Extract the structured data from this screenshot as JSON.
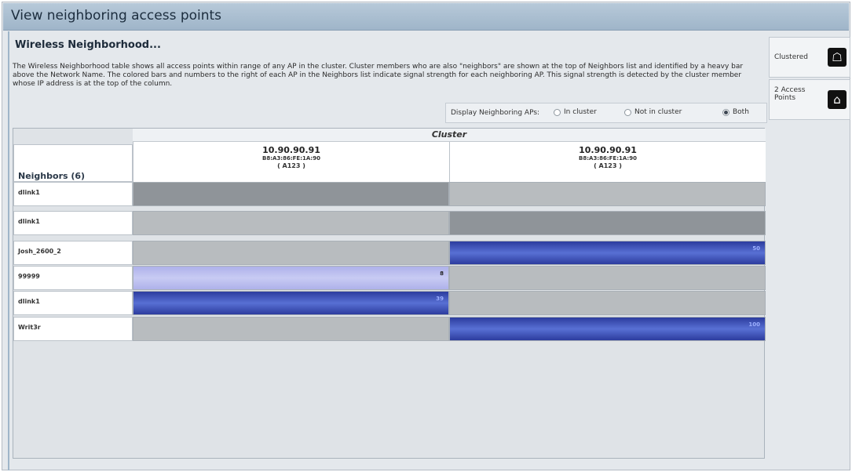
{
  "page_title": "View neighboring access points",
  "section_heading": "Wireless Neighborhood...",
  "description": "The Wireless Neighborhood table shows all access points within range of any AP in the cluster. Cluster members who are also \"neighbors\" are shown at the top of Neighbors list and identified by a heavy bar above the Network Name. The colored bars and numbers to the right of each AP in the Neighbors list indicate signal strength for each neighboring AP. This signal strength is detected by the cluster member whose IP address is at the top of the column.",
  "display_filter": {
    "label": "Display Neighboring APs:",
    "options": [
      {
        "label": "In cluster",
        "selected": false
      },
      {
        "label": "Not in cluster",
        "selected": false
      },
      {
        "label": "Both",
        "selected": true
      }
    ]
  },
  "grid": {
    "cluster_label": "Cluster",
    "neighbors_header": "Neighbors (6)",
    "access_points": [
      {
        "ip": "10.90.90.91",
        "mac": "B8:A3:86:FE:1A:90",
        "name": "( A123 )"
      },
      {
        "ip": "10.90.90.91",
        "mac": "B8:A3:86:FE:1A:90",
        "name": "( A123 )"
      }
    ],
    "rows": [
      {
        "name": "dlink1",
        "signals": [
          {
            "kind": "self",
            "value": ""
          },
          {
            "kind": "empty",
            "value": ""
          }
        ]
      },
      {
        "name": "dlink1",
        "signals": [
          {
            "kind": "empty",
            "value": ""
          },
          {
            "kind": "self",
            "value": ""
          }
        ]
      },
      {
        "name": "Josh_2600_2",
        "signals": [
          {
            "kind": "empty",
            "value": ""
          },
          {
            "kind": "strong",
            "value": "50"
          }
        ]
      },
      {
        "name": "99999",
        "signals": [
          {
            "kind": "weak",
            "value": "8"
          },
          {
            "kind": "empty",
            "value": ""
          }
        ]
      },
      {
        "name": "dlink1",
        "signals": [
          {
            "kind": "strong",
            "value": "39"
          },
          {
            "kind": "empty",
            "value": ""
          }
        ]
      },
      {
        "name": "Writ3r",
        "signals": [
          {
            "kind": "empty",
            "value": ""
          },
          {
            "kind": "strong",
            "value": "100"
          }
        ]
      }
    ]
  },
  "side_panel": {
    "clustered_label": "Clustered",
    "access_points_label": "2 Access Points"
  },
  "colors": {
    "title_bar": "#a9bfd2",
    "strong_signal": "#2c3c9e",
    "weak_signal": "#c8cbf3",
    "self_cell": "#8f9499",
    "empty_cell": "#b8bcbf"
  }
}
